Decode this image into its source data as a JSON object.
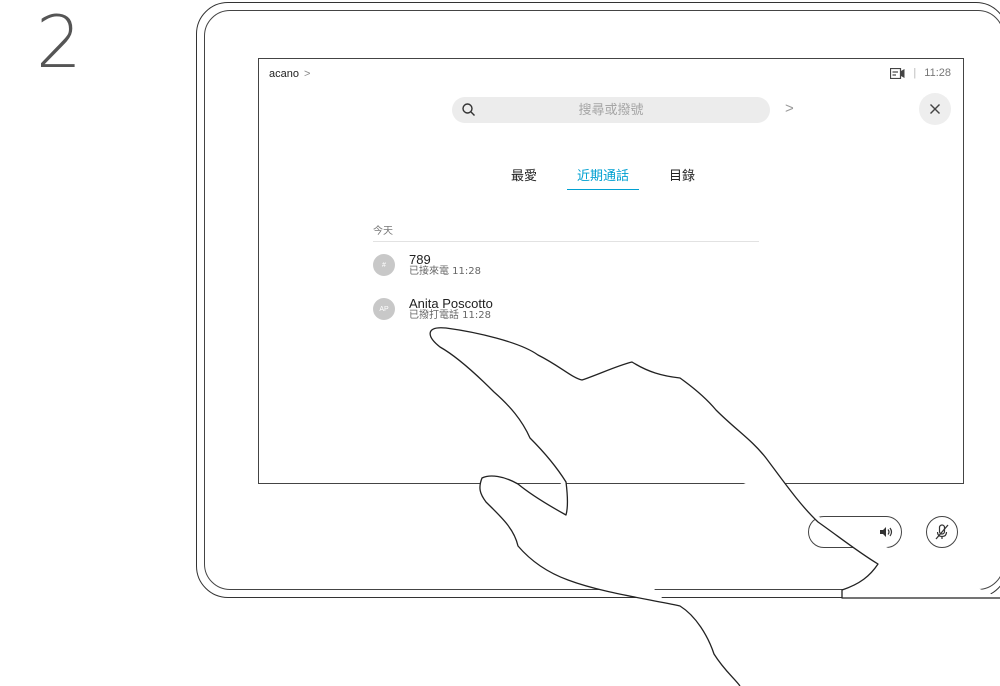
{
  "step_number": "2",
  "header": {
    "breadcrumb": "acano",
    "breadcrumb_chevron": ">",
    "time": "11:28",
    "separator": "|",
    "status_icon": "video-self-view-icon"
  },
  "search": {
    "placeholder": "搜尋或撥號",
    "go_label": ">"
  },
  "close_icon": "close-icon",
  "tabs": [
    {
      "label": "最愛",
      "active": false
    },
    {
      "label": "近期通話",
      "active": true
    },
    {
      "label": "目錄",
      "active": false
    }
  ],
  "recents": {
    "section_label": "今天",
    "items": [
      {
        "avatar": "#",
        "name": "789",
        "detail": "已接來電 11:28"
      },
      {
        "avatar": "AP",
        "name": "Anita Poscotto",
        "detail": "已撥打電話 11:28"
      }
    ]
  },
  "controls": {
    "volume_icon": "speaker-volume-icon",
    "mute_icon": "microphone-mute-icon"
  },
  "colors": {
    "accent": "#00a0d1",
    "avatar": "#c8c8c8"
  }
}
